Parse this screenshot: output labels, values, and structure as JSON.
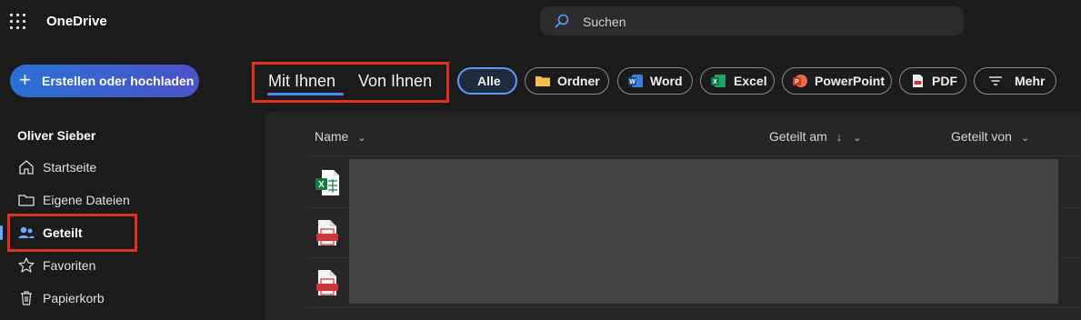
{
  "header": {
    "app_title": "OneDrive",
    "search_placeholder": "Suchen",
    "waffle_icon": "app-launcher-icon"
  },
  "sidebar": {
    "create_label": "Erstellen oder hochladen",
    "user_name": "Oliver Sieber",
    "items": [
      {
        "label": "Startseite",
        "icon": "home-icon"
      },
      {
        "label": "Eigene Dateien",
        "icon": "folder-icon"
      },
      {
        "label": "Geteilt",
        "icon": "people-icon",
        "active": true
      },
      {
        "label": "Favoriten",
        "icon": "star-icon"
      },
      {
        "label": "Papierkorb",
        "icon": "trash-icon"
      }
    ]
  },
  "tabs": [
    {
      "label": "Mit Ihnen",
      "selected": true
    },
    {
      "label": "Von Ihnen",
      "selected": false
    }
  ],
  "filters": [
    {
      "label": "Alle",
      "selected": true
    },
    {
      "label": "Ordner",
      "icon": "folder-icon"
    },
    {
      "label": "Word",
      "icon": "word-icon"
    },
    {
      "label": "Excel",
      "icon": "excel-icon"
    },
    {
      "label": "PowerPoint",
      "icon": "powerpoint-icon"
    },
    {
      "label": "PDF",
      "icon": "pdf-icon"
    },
    {
      "label": "Mehr",
      "icon": "filter-icon"
    }
  ],
  "table": {
    "columns": [
      "Name",
      "Geteilt am",
      "Geteilt von"
    ],
    "rows": [
      {
        "type": "excel"
      },
      {
        "type": "pdf"
      },
      {
        "type": "pdf"
      }
    ]
  },
  "colors": {
    "accent": "#4f8ef7",
    "highlight": "#e0301e",
    "background": "#1b1b1b"
  }
}
